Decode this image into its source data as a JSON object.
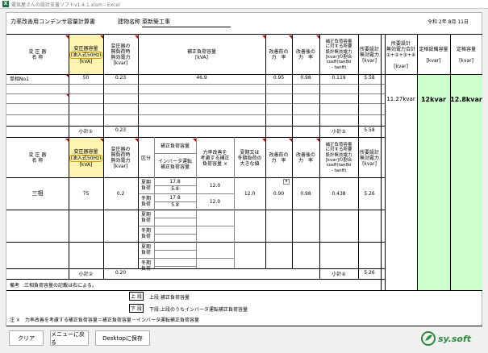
{
  "window": {
    "title": "電気屋さんの設計支援ソフトv1.4.1.xlsm - Excel"
  },
  "sheet": {
    "doc_title": "力率改善用コンデンサ容量計算書",
    "building_label": "建物名称",
    "building_name": "菜新築工事",
    "date": "令和 2年 8月 11日",
    "headers": {
      "equipment_line1": "変 圧 器",
      "equipment_line2": "名 称",
      "capacity_line1": "変圧器容量",
      "capacity_line2": "(油入式50Hz)",
      "capacity_unit": "[kVA]",
      "noload_line1": "変圧器の",
      "noload_line2": "無負荷時",
      "noload_line3": "無効電力",
      "noload_unit": "[kvar]",
      "corrected_load": "補正負荷容量",
      "corrected_unit": "[kVA]",
      "pf_before_line1": "改善前の",
      "pf_before_line2": "力　率",
      "pf_after_line1": "改善後の",
      "pf_after_line2": "力　率",
      "ratio_line1": "補正負荷容量",
      "ratio_line2": "に対する所要",
      "ratio_line3": "設計無効電力",
      "ratio_line4": "[kvar]の割合",
      "ratio_line5": "cosθ(tanθo",
      "ratio_line6": "- tanθ)",
      "required_line1": "所要設計",
      "required_line2": "無効電力",
      "required_unit": "[kvar]",
      "total_line1": "所要設計",
      "total_line2": "無効電力合計",
      "total_line3": "①+②+③+④",
      "total_unit": "[kvar]",
      "rated_line1": "定格設備容量",
      "rated_unit": "[kvar]",
      "rated2_line1": "定格容量",
      "rated2_unit": "[kvar]",
      "capacity2_line2": "(油入式50Hz)"
    },
    "section1": {
      "row1": {
        "name": "単相No1",
        "capacity": "50",
        "noload": "0.23",
        "corrected": "46.9",
        "pf_before": "0.95",
        "pf_after": "0.98",
        "ratio": "0.119",
        "required": "5.58"
      },
      "subtotal_label": "小計①",
      "subtotal_noload": "0.23",
      "subtotal3_label": "小計③",
      "subtotal3_value": "5.58"
    },
    "summary": {
      "total": "11.27kvar",
      "rated_equipment": "12kvar",
      "rated": "12.8kvar"
    },
    "section2": {
      "kubun": "区分",
      "col_corrected_line1": "補正負荷容量",
      "col_inverter_line1": "インバータ運転",
      "col_inverter_line2": "補正負荷容量",
      "col_improve_line1": "力率改善を",
      "col_improve_line2": "考慮する補正",
      "col_improve_line3": "負荷容量 ×",
      "col_season_line1": "夏期又は",
      "col_season_line2": "冬期負荷の",
      "col_season_line3": "大きな値",
      "summer": "夏期",
      "summer2": "負荷",
      "winter": "冬期",
      "winter2": "負荷",
      "row1": {
        "name": "三相",
        "capacity": "75",
        "noload": "0.2",
        "summer_corr": "17.8",
        "summer_inv": "5.8",
        "winter_corr": "17.8",
        "winter_inv": "5.8",
        "summer_improve": "12.0",
        "winter_improve": "12.0",
        "max": "12.0",
        "pf_before": "0.90",
        "pf_after": "0.98",
        "ratio": "0.438",
        "required": "5.26"
      },
      "subtotal2_label": "小計②",
      "subtotal2_value": "0.20",
      "subtotal4_label": "小計④",
      "subtotal4_value": "5.26"
    },
    "notes": {
      "remark": "備考　三相負荷容量の記載は右による。",
      "upper_box": "上 段",
      "upper_text": "上段:補正負荷容量",
      "lower_box": "下 段",
      "lower_text": "下段:上段のうちインバータ運転補正負荷容量",
      "footnote": "注 ×　力率改善を考慮する補正負荷容量＝補正負荷容量－インバータ運転補正負荷容量"
    }
  },
  "buttons": {
    "clear": "クリア",
    "menu": "メニューに戻る",
    "desktop": "Desktopに保存"
  },
  "logo": {
    "text": "sy.soft"
  },
  "colors": {
    "green_fill": "#ccffcc",
    "yellow_fill": "#fff3b0",
    "logo_green": "#2e8b3e",
    "excel_green": "#1e7145"
  }
}
